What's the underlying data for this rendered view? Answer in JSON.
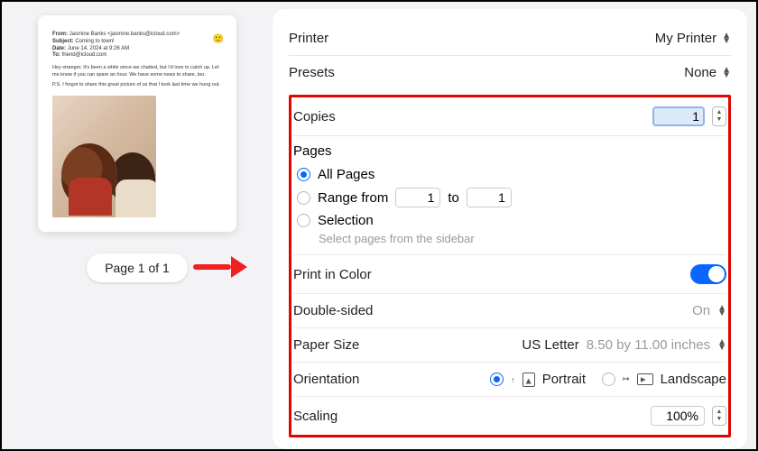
{
  "preview": {
    "meta": {
      "from_label": "From:",
      "from_value": "Jasmine Banks <jasmine.banks@icloud.com>",
      "subject_label": "Subject:",
      "subject_value": "Coming to town!",
      "date_label": "Date:",
      "date_value": "June 14, 2024 at 9:26 AM",
      "to_label": "To:",
      "to_value": "friend@icloud.com"
    },
    "body_line1": "Hey stranger. It's been a while since we chatted, but I'd love to catch up. Let me know if you can spare an hour. We have some news to share, too.",
    "body_line2": "P.S. I forgot to share this great picture of us that I took last time we hung out.",
    "page_indicator": "Page 1 of 1"
  },
  "header": {
    "printer_label": "Printer",
    "printer_value": "My Printer",
    "presets_label": "Presets",
    "presets_value": "None"
  },
  "options": {
    "copies_label": "Copies",
    "copies_value": "1",
    "pages": {
      "title": "Pages",
      "all": "All Pages",
      "range_prefix": "Range from",
      "range_from": "1",
      "range_to_word": "to",
      "range_to": "1",
      "selection": "Selection",
      "selection_hint": "Select pages from the sidebar"
    },
    "color_label": "Print in Color",
    "double_label": "Double-sided",
    "double_value": "On",
    "paper_label": "Paper Size",
    "paper_value": "US Letter",
    "paper_dim": "8.50 by 11.00 inches",
    "orient_label": "Orientation",
    "orient_portrait": "Portrait",
    "orient_landscape": "Landscape",
    "scaling_label": "Scaling",
    "scaling_value": "100%"
  }
}
